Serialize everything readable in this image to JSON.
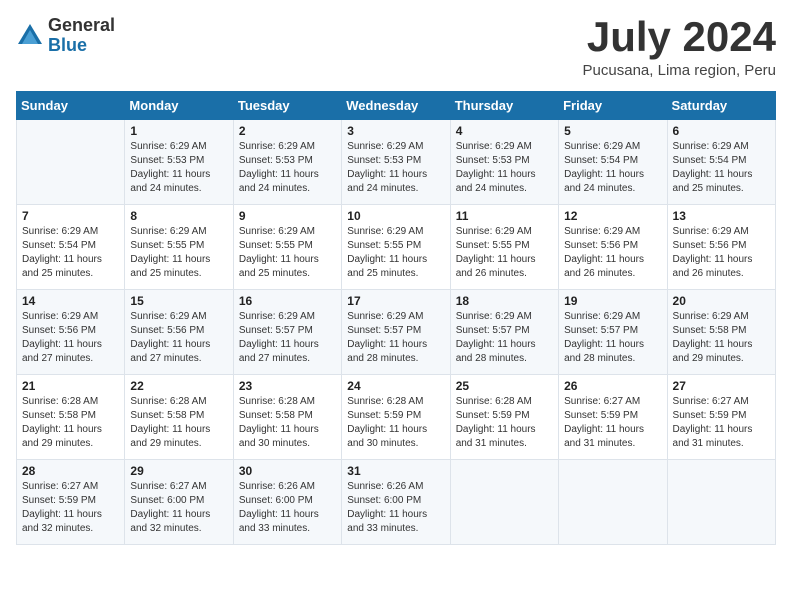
{
  "logo": {
    "general": "General",
    "blue": "Blue"
  },
  "title": {
    "month_year": "July 2024",
    "location": "Pucusana, Lima region, Peru"
  },
  "days_of_week": [
    "Sunday",
    "Monday",
    "Tuesday",
    "Wednesday",
    "Thursday",
    "Friday",
    "Saturday"
  ],
  "weeks": [
    [
      {
        "day": "",
        "sunrise": "",
        "sunset": "",
        "daylight": ""
      },
      {
        "day": "1",
        "sunrise": "Sunrise: 6:29 AM",
        "sunset": "Sunset: 5:53 PM",
        "daylight": "Daylight: 11 hours and 24 minutes."
      },
      {
        "day": "2",
        "sunrise": "Sunrise: 6:29 AM",
        "sunset": "Sunset: 5:53 PM",
        "daylight": "Daylight: 11 hours and 24 minutes."
      },
      {
        "day": "3",
        "sunrise": "Sunrise: 6:29 AM",
        "sunset": "Sunset: 5:53 PM",
        "daylight": "Daylight: 11 hours and 24 minutes."
      },
      {
        "day": "4",
        "sunrise": "Sunrise: 6:29 AM",
        "sunset": "Sunset: 5:53 PM",
        "daylight": "Daylight: 11 hours and 24 minutes."
      },
      {
        "day": "5",
        "sunrise": "Sunrise: 6:29 AM",
        "sunset": "Sunset: 5:54 PM",
        "daylight": "Daylight: 11 hours and 24 minutes."
      },
      {
        "day": "6",
        "sunrise": "Sunrise: 6:29 AM",
        "sunset": "Sunset: 5:54 PM",
        "daylight": "Daylight: 11 hours and 25 minutes."
      }
    ],
    [
      {
        "day": "7",
        "sunrise": "Sunrise: 6:29 AM",
        "sunset": "Sunset: 5:54 PM",
        "daylight": "Daylight: 11 hours and 25 minutes."
      },
      {
        "day": "8",
        "sunrise": "Sunrise: 6:29 AM",
        "sunset": "Sunset: 5:55 PM",
        "daylight": "Daylight: 11 hours and 25 minutes."
      },
      {
        "day": "9",
        "sunrise": "Sunrise: 6:29 AM",
        "sunset": "Sunset: 5:55 PM",
        "daylight": "Daylight: 11 hours and 25 minutes."
      },
      {
        "day": "10",
        "sunrise": "Sunrise: 6:29 AM",
        "sunset": "Sunset: 5:55 PM",
        "daylight": "Daylight: 11 hours and 25 minutes."
      },
      {
        "day": "11",
        "sunrise": "Sunrise: 6:29 AM",
        "sunset": "Sunset: 5:55 PM",
        "daylight": "Daylight: 11 hours and 26 minutes."
      },
      {
        "day": "12",
        "sunrise": "Sunrise: 6:29 AM",
        "sunset": "Sunset: 5:56 PM",
        "daylight": "Daylight: 11 hours and 26 minutes."
      },
      {
        "day": "13",
        "sunrise": "Sunrise: 6:29 AM",
        "sunset": "Sunset: 5:56 PM",
        "daylight": "Daylight: 11 hours and 26 minutes."
      }
    ],
    [
      {
        "day": "14",
        "sunrise": "Sunrise: 6:29 AM",
        "sunset": "Sunset: 5:56 PM",
        "daylight": "Daylight: 11 hours and 27 minutes."
      },
      {
        "day": "15",
        "sunrise": "Sunrise: 6:29 AM",
        "sunset": "Sunset: 5:56 PM",
        "daylight": "Daylight: 11 hours and 27 minutes."
      },
      {
        "day": "16",
        "sunrise": "Sunrise: 6:29 AM",
        "sunset": "Sunset: 5:57 PM",
        "daylight": "Daylight: 11 hours and 27 minutes."
      },
      {
        "day": "17",
        "sunrise": "Sunrise: 6:29 AM",
        "sunset": "Sunset: 5:57 PM",
        "daylight": "Daylight: 11 hours and 28 minutes."
      },
      {
        "day": "18",
        "sunrise": "Sunrise: 6:29 AM",
        "sunset": "Sunset: 5:57 PM",
        "daylight": "Daylight: 11 hours and 28 minutes."
      },
      {
        "day": "19",
        "sunrise": "Sunrise: 6:29 AM",
        "sunset": "Sunset: 5:57 PM",
        "daylight": "Daylight: 11 hours and 28 minutes."
      },
      {
        "day": "20",
        "sunrise": "Sunrise: 6:29 AM",
        "sunset": "Sunset: 5:58 PM",
        "daylight": "Daylight: 11 hours and 29 minutes."
      }
    ],
    [
      {
        "day": "21",
        "sunrise": "Sunrise: 6:28 AM",
        "sunset": "Sunset: 5:58 PM",
        "daylight": "Daylight: 11 hours and 29 minutes."
      },
      {
        "day": "22",
        "sunrise": "Sunrise: 6:28 AM",
        "sunset": "Sunset: 5:58 PM",
        "daylight": "Daylight: 11 hours and 29 minutes."
      },
      {
        "day": "23",
        "sunrise": "Sunrise: 6:28 AM",
        "sunset": "Sunset: 5:58 PM",
        "daylight": "Daylight: 11 hours and 30 minutes."
      },
      {
        "day": "24",
        "sunrise": "Sunrise: 6:28 AM",
        "sunset": "Sunset: 5:59 PM",
        "daylight": "Daylight: 11 hours and 30 minutes."
      },
      {
        "day": "25",
        "sunrise": "Sunrise: 6:28 AM",
        "sunset": "Sunset: 5:59 PM",
        "daylight": "Daylight: 11 hours and 31 minutes."
      },
      {
        "day": "26",
        "sunrise": "Sunrise: 6:27 AM",
        "sunset": "Sunset: 5:59 PM",
        "daylight": "Daylight: 11 hours and 31 minutes."
      },
      {
        "day": "27",
        "sunrise": "Sunrise: 6:27 AM",
        "sunset": "Sunset: 5:59 PM",
        "daylight": "Daylight: 11 hours and 31 minutes."
      }
    ],
    [
      {
        "day": "28",
        "sunrise": "Sunrise: 6:27 AM",
        "sunset": "Sunset: 5:59 PM",
        "daylight": "Daylight: 11 hours and 32 minutes."
      },
      {
        "day": "29",
        "sunrise": "Sunrise: 6:27 AM",
        "sunset": "Sunset: 6:00 PM",
        "daylight": "Daylight: 11 hours and 32 minutes."
      },
      {
        "day": "30",
        "sunrise": "Sunrise: 6:26 AM",
        "sunset": "Sunset: 6:00 PM",
        "daylight": "Daylight: 11 hours and 33 minutes."
      },
      {
        "day": "31",
        "sunrise": "Sunrise: 6:26 AM",
        "sunset": "Sunset: 6:00 PM",
        "daylight": "Daylight: 11 hours and 33 minutes."
      },
      {
        "day": "",
        "sunrise": "",
        "sunset": "",
        "daylight": ""
      },
      {
        "day": "",
        "sunrise": "",
        "sunset": "",
        "daylight": ""
      },
      {
        "day": "",
        "sunrise": "",
        "sunset": "",
        "daylight": ""
      }
    ]
  ]
}
